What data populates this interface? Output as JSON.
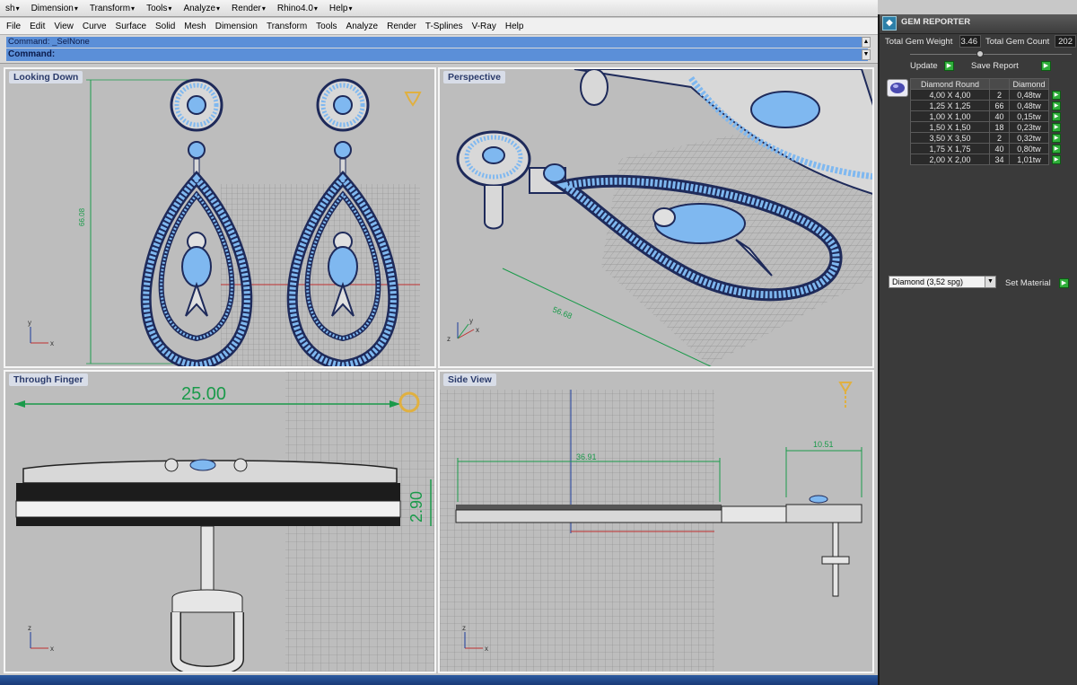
{
  "topbar": {
    "items": [
      "sh",
      "Dimension",
      "Transform",
      "Tools",
      "Analyze",
      "Render",
      "Rhino4.0",
      "Help"
    ]
  },
  "menubar": {
    "items": [
      "File",
      "Edit",
      "View",
      "Curve",
      "Surface",
      "Solid",
      "Mesh",
      "Dimension",
      "Transform",
      "Tools",
      "Analyze",
      "Render",
      "T-Splines",
      "V-Ray",
      "Help"
    ]
  },
  "command": {
    "history": "Command: _SelNone",
    "prompt": "Command:"
  },
  "viewports": {
    "top_left": {
      "title": "Looking Down",
      "dimension": "66.08",
      "axis_x": "x",
      "axis_y": "y"
    },
    "top_right": {
      "title": "Perspective",
      "dimension": "56.68",
      "axis_x": "x",
      "axis_y": "y",
      "axis_z": "z"
    },
    "bottom_left": {
      "title": "Through Finger",
      "dimension_width": "25.00",
      "dimension_height": "2.90",
      "axis_x": "x",
      "axis_z": "z"
    },
    "bottom_right": {
      "title": "Side View",
      "dimension_a": "36.91",
      "dimension_b": "10.51",
      "axis_x": "x",
      "axis_z": "z"
    }
  },
  "gem_reporter": {
    "title": "GEM REPORTER",
    "total_weight_label": "Total Gem Weight",
    "total_weight_value": "3.46",
    "total_count_label": "Total Gem Count",
    "total_count_value": "202",
    "update_label": "Update",
    "save_report_label": "Save Report",
    "table_headers": [
      "Diamond Round",
      "",
      "Diamond"
    ],
    "rows": [
      [
        "4,00 X 4,00",
        "2",
        "0,48tw"
      ],
      [
        "1,25 X 1,25",
        "66",
        "0,48tw"
      ],
      [
        "1,00 X 1,00",
        "40",
        "0,15tw"
      ],
      [
        "1,50 X 1,50",
        "18",
        "0,23tw"
      ],
      [
        "3,50 X 3,50",
        "2",
        "0,32tw"
      ],
      [
        "1,75 X 1,75",
        "40",
        "0,80tw"
      ],
      [
        "2,00 X 2,00",
        "34",
        "1,01tw"
      ]
    ],
    "material_select": "Diamond  (3,52 spg)",
    "set_material_label": "Set Material"
  },
  "colors": {
    "viewport_bg": "#bdbdbd",
    "gem_blue": "#7fb8f0",
    "metal": "#d8d8d8",
    "outline": "#1e2a5a",
    "dim_green": "#1a9a4a",
    "grid": "#8f8f8f"
  }
}
